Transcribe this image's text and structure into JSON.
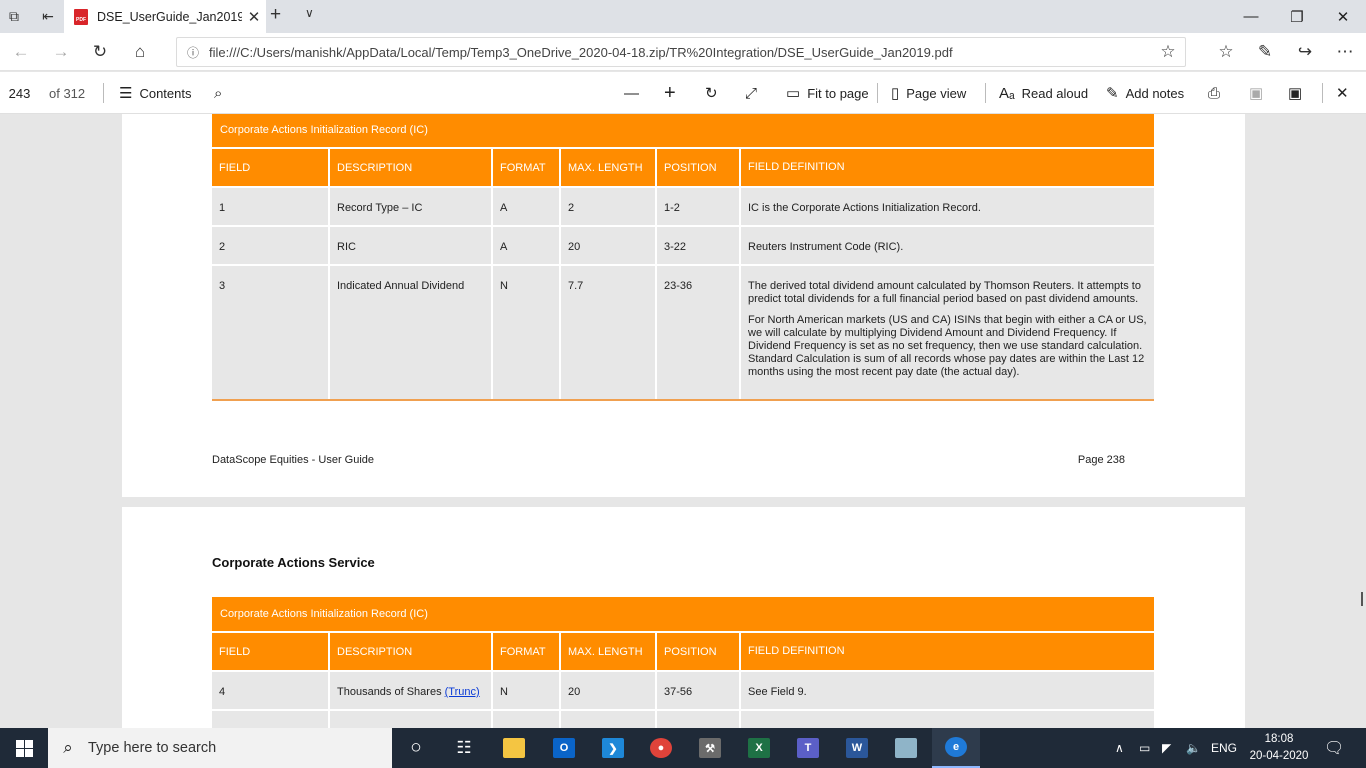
{
  "browser": {
    "tab_title": "DSE_UserGuide_Jan2019",
    "pdf_badge": "PDF",
    "url": "file:///C:/Users/manishk/AppData/Local/Temp/Temp3_OneDrive_2020-04-18.zip/TR%20Integration/DSE_UserGuide_Jan2019.pdf"
  },
  "pdf_toolbar": {
    "page_number": "243",
    "page_total": "of 312",
    "contents_label": "Contents",
    "fit_to_page_label": "Fit to page",
    "page_view_label": "Page view",
    "read_aloud_label": "Read aloud",
    "add_notes_label": "Add notes"
  },
  "page1": {
    "table_title": "Corporate Actions Initialization Record (IC)",
    "headers": [
      "FIELD",
      "DESCRIPTION",
      "FORMAT",
      "MAX. LENGTH",
      "POSITION",
      "FIELD DEFINITION"
    ],
    "rows": [
      {
        "field": "1",
        "description": "Record Type – IC",
        "format": "A",
        "max_length": "2",
        "position": "1-2",
        "definition": [
          "IC is the Corporate Actions Initialization Record."
        ]
      },
      {
        "field": "2",
        "description": "RIC",
        "format": "A",
        "max_length": "20",
        "position": "3-22",
        "definition": [
          "Reuters Instrument Code (RIC)."
        ]
      },
      {
        "field": "3",
        "description": "Indicated Annual Dividend",
        "format": "N",
        "max_length": "7.7",
        "position": "23-36",
        "definition": [
          "The derived total dividend amount calculated by Thomson Reuters. It attempts to predict total dividends for a full financial period based on past dividend amounts.",
          "For North American markets (US and CA) ISINs that begin with either a CA or US, we will calculate by multiplying Dividend Amount and Dividend Frequency. If Dividend Frequency is set as no set frequency, then we use standard calculation. Standard Calculation is sum of all records whose pay dates are within the Last 12 months using the most recent pay date (the actual day)."
        ]
      }
    ],
    "footer_left": "DataScope Equities - User Guide",
    "footer_right": "Page 238"
  },
  "page2": {
    "section_title": "Corporate Actions Service",
    "table_title": "Corporate Actions Initialization Record (IC)",
    "headers": [
      "FIELD",
      "DESCRIPTION",
      "FORMAT",
      "MAX. LENGTH",
      "POSITION",
      "FIELD DEFINITION"
    ],
    "rows": [
      {
        "field": "4",
        "description": "Thousands of Shares",
        "link": "(Trunc)",
        "format": "N",
        "max_length": "20",
        "position": "37-56",
        "definition": "See Field 9."
      }
    ]
  },
  "taskbar": {
    "search_placeholder": "Type here to search",
    "language": "ENG",
    "time": "18:08",
    "date": "20-04-2020",
    "apps": [
      "task-view",
      "file-explorer",
      "outlook",
      "vscode",
      "chrome",
      "tools",
      "excel",
      "teams",
      "word",
      "notes",
      "edge"
    ]
  },
  "colors": {
    "table_orange": "#ff8c00",
    "cell_gray": "#e7e7e7",
    "taskbar": "#1f2a38"
  }
}
